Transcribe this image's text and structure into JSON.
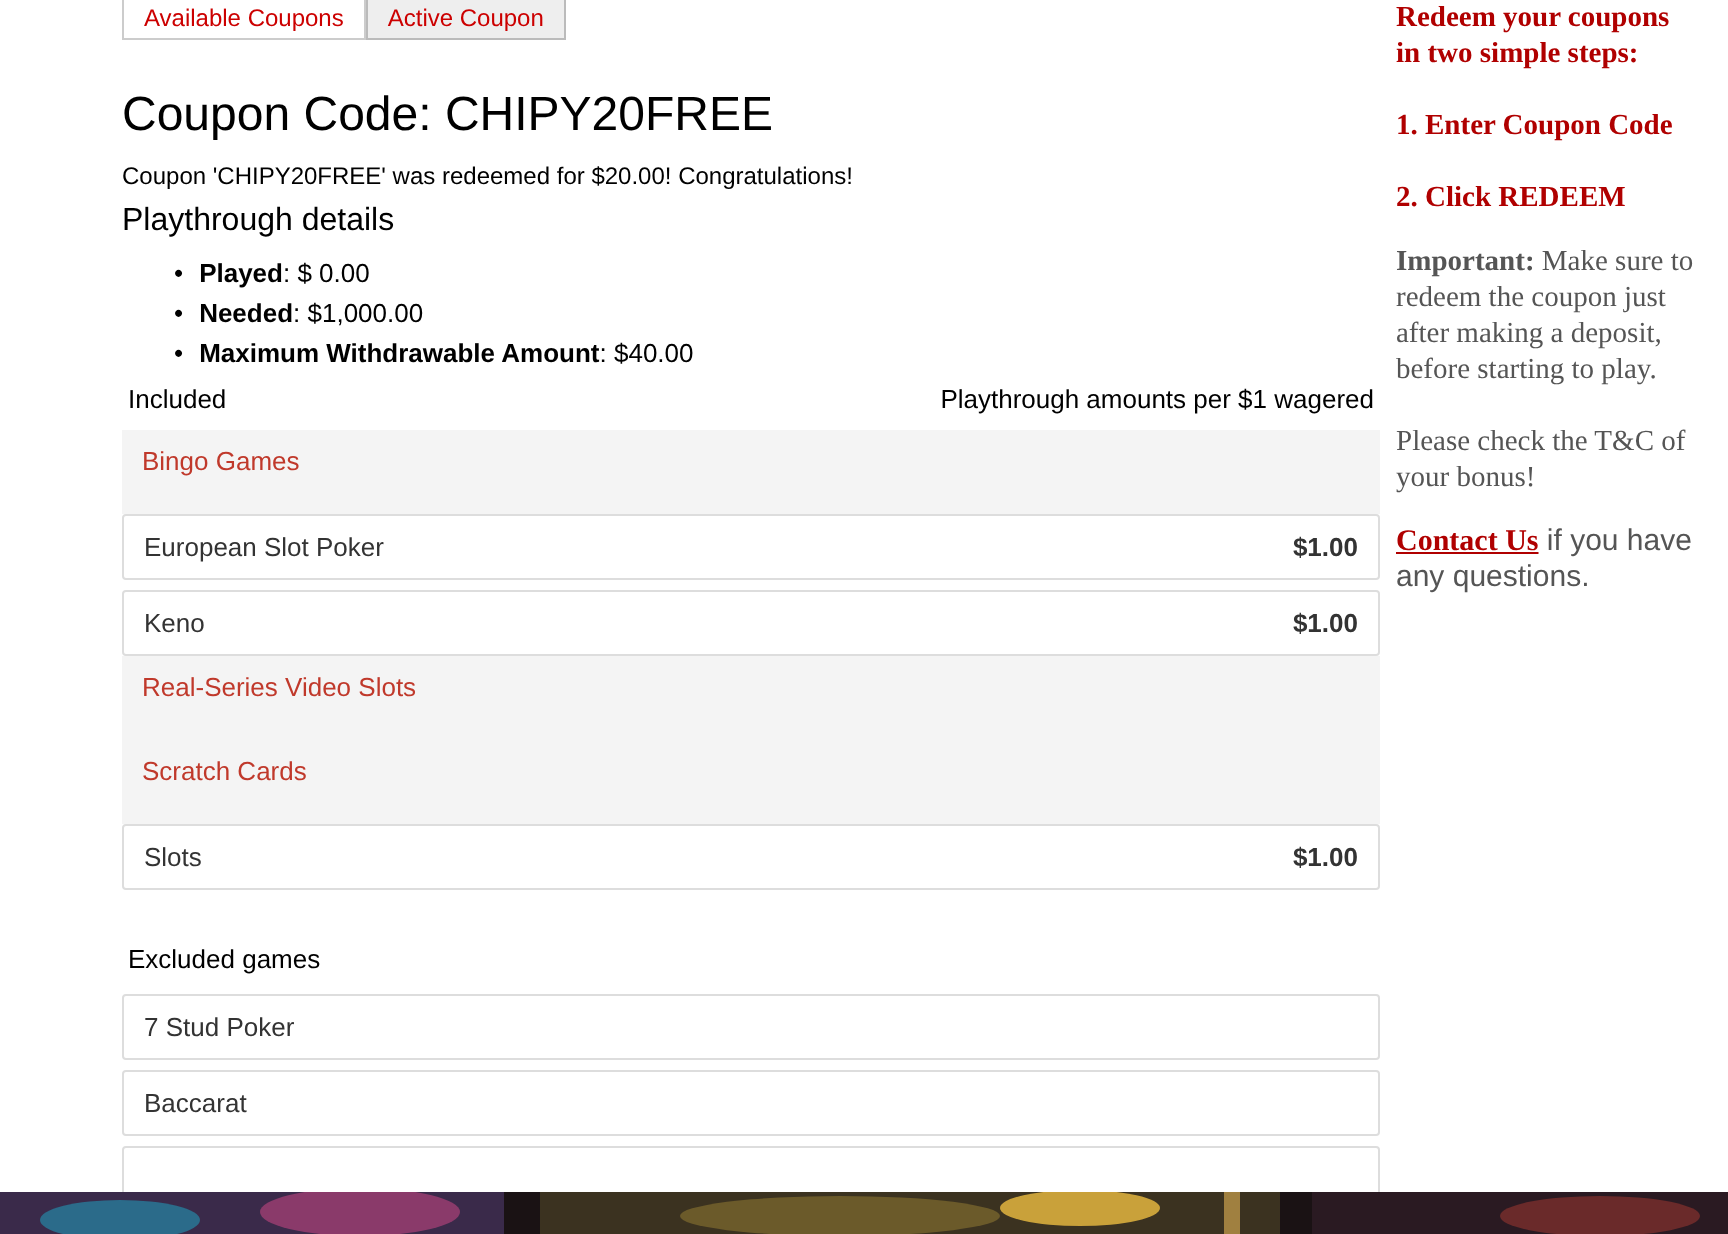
{
  "tabs": [
    {
      "label": "Available Coupons",
      "selected": false
    },
    {
      "label": "Active Coupon",
      "selected": true
    }
  ],
  "coupon": {
    "title": "Coupon Code: CHIPY20FREE",
    "message": "Coupon 'CHIPY20FREE' was redeemed for $20.00! Congratulations!"
  },
  "playthrough": {
    "heading": "Playthrough details",
    "items": [
      {
        "bullet": "•",
        "label": "Played",
        "value": ": $ 0.00"
      },
      {
        "bullet": "•",
        "label": "Needed",
        "value": ": $1,000.00"
      },
      {
        "bullet": "•",
        "label": "Maximum Withdrawable Amount",
        "value": ": $40.00"
      }
    ]
  },
  "included": {
    "column_1": "Included",
    "column_2": "Playthrough amounts per $1 wagered",
    "rows": [
      {
        "kind": "category",
        "name": "Bingo Games"
      },
      {
        "kind": "game",
        "name": "European Slot Poker",
        "amount": "$1.00"
      },
      {
        "kind": "game",
        "name": "Keno",
        "amount": "$1.00"
      },
      {
        "kind": "category",
        "name": "Real-Series Video Slots"
      },
      {
        "kind": "category",
        "name": "Scratch Cards"
      },
      {
        "kind": "game",
        "name": "Slots",
        "amount": "$1.00"
      }
    ]
  },
  "excluded": {
    "heading": "Excluded games",
    "rows": [
      "7 Stud Poker",
      "Baccarat"
    ]
  },
  "sidebar": {
    "intro": "Redeem your coupons in two simple steps:",
    "steps": [
      "1. Enter Coupon Code",
      "2. Click REDEEM"
    ],
    "important": "**Important:** Make sure to redeem the coupon just after making a deposit, before starting to play.",
    "note": "Please check the T&C of your bonus!",
    "contact_link": "Contact Us",
    "contact_text": " if you have any questions."
  }
}
